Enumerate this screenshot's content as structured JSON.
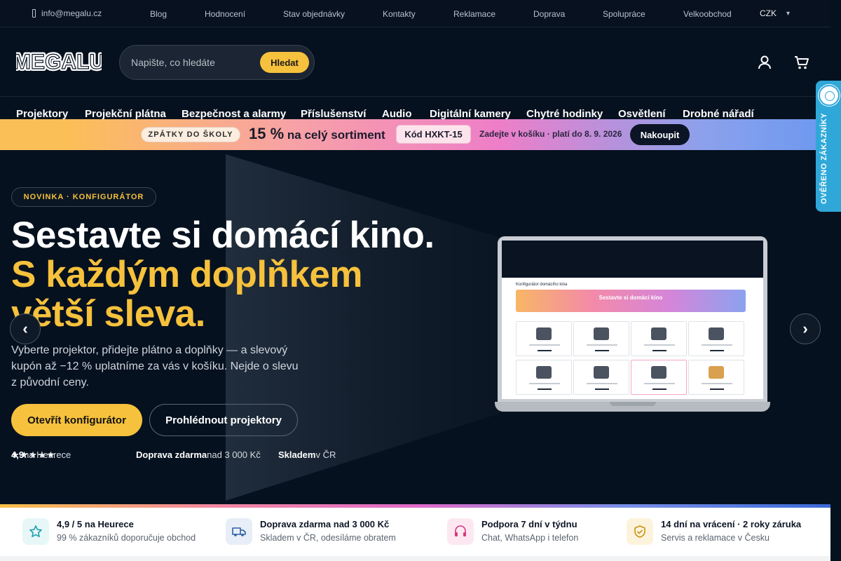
{
  "topbar": {
    "email": "info@megalu.cz",
    "links": [
      "Blog",
      "Hodnocení",
      "Stav objednávky",
      "Kontakty",
      "Reklamace",
      "Doprava",
      "Spolupráce",
      "Velkoobchod"
    ],
    "currency": "CZK"
  },
  "header": {
    "logo_text": "MEGALU",
    "search_placeholder": "Napište, co hledáte",
    "search_button": "Hledat"
  },
  "categories": [
    "Projektory",
    "Projekční plátna",
    "Bezpečnost a alarmy",
    "Příslušenství",
    "Audio",
    "Digitální kamery",
    "Chytré hodinky",
    "Osvětlení",
    "Drobné nářadí"
  ],
  "promo": {
    "tag": "ZPÁTKY DO ŠKOLY",
    "percent": "15 %",
    "percent_rest": "na celý sortiment",
    "code": "Kód HXKT-15",
    "note": "Zadejte v košíku · platí do 8. 9. 2026",
    "cta": "Nakoupit"
  },
  "verified_badge": "OVĚŘENO ZÁKAZNÍKY",
  "hero": {
    "badge": "NOVINKA · KONFIGURÁTOR",
    "title_line1": "Sestavte si domácí kino.",
    "title_line2": "S každým doplňkem",
    "title_line3": "větší sleva.",
    "subtitle": "Vyberte projektor, přidejte plátno a doplňky — a slevový kupón až −12 % uplatníme za vás v košíku. Nejde o slevu z původní ceny.",
    "primary_button": "Otevřít konfigurátor",
    "secondary_button": "Prohlédnout projektory",
    "rating_stars": "★★★★★",
    "rating_value": "4,9",
    "rating_suffix": "na Heurece",
    "shipping_bold": "Doprava zdarma",
    "shipping_rest": "nad 3 000 Kč",
    "stock_bold": "Skladem",
    "stock_rest": "v ČR",
    "prev_arrow": "‹",
    "next_arrow": "›",
    "screen_banner": "Sestavte si domácí kino",
    "screen_heading": "Konfigurátor domácího kina"
  },
  "trust": [
    {
      "title": "4,9 / 5 na Heurece",
      "desc": "99 % zákazníků doporučuje obchod",
      "icon": "star-icon",
      "bg": "#e7f7f8",
      "color": "#1f9fae"
    },
    {
      "title": "Doprava zdarma nad 3 000 Kč",
      "desc": "Skladem v ČR, odesíláme obratem",
      "icon": "truck-icon",
      "bg": "#e8eef7",
      "color": "#2c5fa8"
    },
    {
      "title": "Podpora 7 dní v týdnu",
      "desc": "Chat, WhatsApp i telefon",
      "icon": "headset-icon",
      "bg": "#fde8f2",
      "color": "#d8387e"
    },
    {
      "title": "14 dní na vrácení · 2 roky záruka",
      "desc": "Servis a reklamace v Česku",
      "icon": "shield-check-icon",
      "bg": "#fdf3dc",
      "color": "#c99212"
    }
  ],
  "colors": {
    "accent": "#f6c13c",
    "bg": "#06111f"
  }
}
